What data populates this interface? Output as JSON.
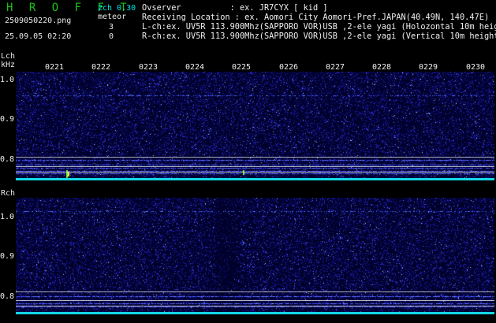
{
  "header": {
    "brand": "H R O F F T",
    "channels": "2ch 0.30",
    "filename": "2509050220.png",
    "meteor_label": "meteor",
    "lch_count": "3",
    "datetime": "25.09.05 02:20",
    "rch_count": "0"
  },
  "station": {
    "observer": "Ovserver          : ex. JR7CYX [ kid ]",
    "location": "Receiving Location : ex. Aomori City Aomori-Pref.JAPAN(40.49N, 140.47E)",
    "lch": "L-ch:ex. UV5R 113.900Mhz(SAPPORO VOR)USB ,2-ele yagi (Holozontal 10m height)",
    "rch": "R-ch:ex. UV5R 113.900Mhz(SAPPORO VOR)USB ,2-ele yagi (Vertical 10m height)"
  },
  "axes": {
    "lch_label": "Lch",
    "unit": "kHz",
    "rch_label": "Rch",
    "time_ticks": [
      "0221",
      "0222",
      "0223",
      "0224",
      "0225",
      "0226",
      "0227",
      "0228",
      "0229",
      "0230"
    ],
    "freq_ticks": [
      "1.0",
      "0.9",
      "0.8"
    ]
  },
  "colors": {
    "brand": "#19c219",
    "background": "#000000",
    "panel": "#00002a",
    "noise": "#2a2ad6",
    "baseline": "#14d6e6"
  }
}
